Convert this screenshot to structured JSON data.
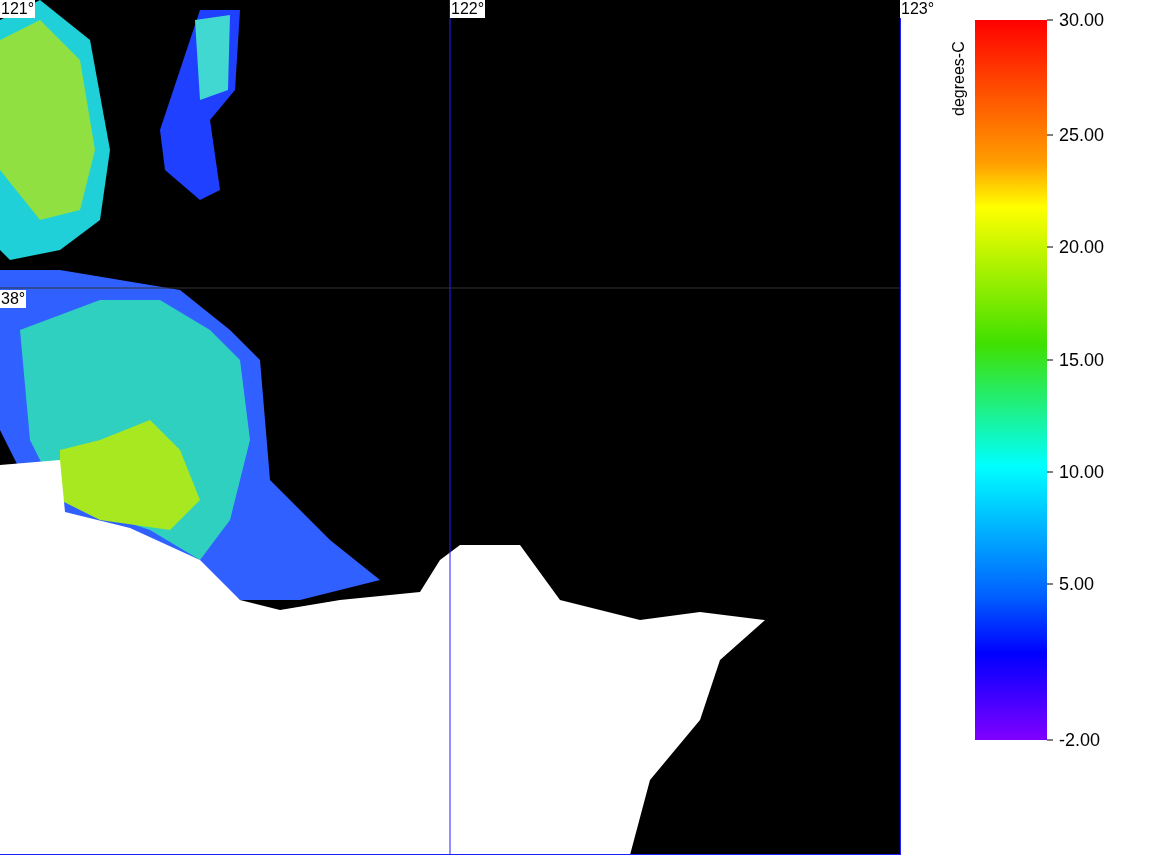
{
  "map": {
    "longitude_labels": [
      "121°",
      "122°",
      "123°"
    ],
    "latitude_labels": [
      "38°"
    ]
  },
  "color_scale": {
    "title": "degrees-C",
    "ticks": [
      "30.00",
      "25.00",
      "20.00",
      "15.00",
      "10.00",
      "5.00",
      "-2.00"
    ]
  }
}
